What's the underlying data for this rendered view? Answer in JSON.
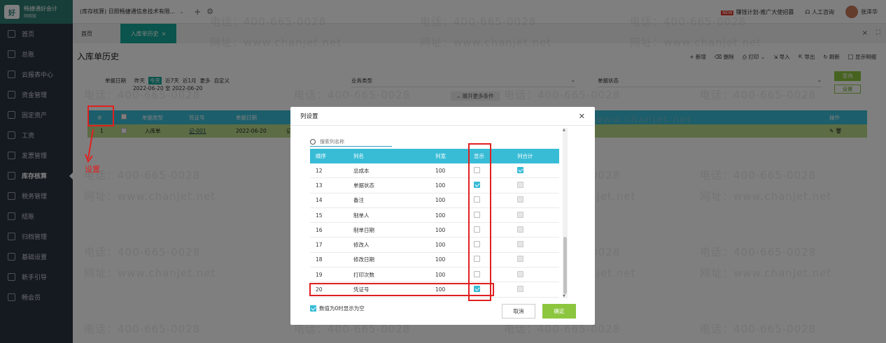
{
  "app": {
    "logo_title": "畅捷通好会计",
    "logo_sub": "网络版",
    "logo_mark": "好"
  },
  "topbar": {
    "account": "(库存核算) 日照畅捷通信息技术有限...",
    "promo": "赚钱计划-推广大使招募",
    "promo_badge": "NEW",
    "support": "人工咨询",
    "user": "张泽华"
  },
  "sidebar": {
    "items": [
      {
        "label": "首页"
      },
      {
        "label": "总账"
      },
      {
        "label": "云报表中心"
      },
      {
        "label": "资金管理"
      },
      {
        "label": "固定资产"
      },
      {
        "label": "工资"
      },
      {
        "label": "发票管理"
      },
      {
        "label": "库存核算"
      },
      {
        "label": "税务管理"
      },
      {
        "label": "结账"
      },
      {
        "label": "归档管理"
      },
      {
        "label": "基础设置"
      },
      {
        "label": "新手引导"
      },
      {
        "label": "畅会员"
      }
    ]
  },
  "tabs": {
    "home": "首页",
    "active": "入库单历史"
  },
  "page": {
    "title": "入库单历史",
    "toolbar": [
      "新增",
      "删除",
      "打印",
      "导入",
      "导出",
      "刷新",
      "显示明细"
    ]
  },
  "filters": {
    "date_label": "单据日期",
    "quick": [
      "昨天",
      "今天",
      "近7天",
      "近1月",
      "更多",
      "自定义"
    ],
    "date_range": "2022-06-20 至 2022-06-20",
    "biz_type_label": "业务类型",
    "status_label": "单据状态",
    "query_button": "查询",
    "settings_button": "设置",
    "more_conditions": "展开更多条件"
  },
  "main_table": {
    "headers": [
      "单据类型",
      "凭证号",
      "单据日期",
      "操作"
    ],
    "row": {
      "no": "1",
      "type": "入库单",
      "voucher": "记-001",
      "date": "2022-06-20",
      "extra": "记"
    }
  },
  "dialog": {
    "title": "列设置",
    "search_placeholder": "搜索列名称",
    "headers": [
      "顺序",
      "列名",
      "列宽",
      "显示",
      "列合计"
    ],
    "rows": [
      {
        "order": "12",
        "name": "总成本",
        "width": "100",
        "show": false,
        "sum": true
      },
      {
        "order": "13",
        "name": "单据状态",
        "width": "100",
        "show": true,
        "sum": false
      },
      {
        "order": "14",
        "name": "备注",
        "width": "100",
        "show": false,
        "sum": false
      },
      {
        "order": "15",
        "name": "制单人",
        "width": "100",
        "show": false,
        "sum": false
      },
      {
        "order": "16",
        "name": "制单日期",
        "width": "100",
        "show": false,
        "sum": false
      },
      {
        "order": "17",
        "name": "修改人",
        "width": "100",
        "show": false,
        "sum": false
      },
      {
        "order": "18",
        "name": "修改日期",
        "width": "100",
        "show": false,
        "sum": false
      },
      {
        "order": "19",
        "name": "打印次数",
        "width": "100",
        "show": false,
        "sum": false
      },
      {
        "order": "20",
        "name": "凭证号",
        "width": "100",
        "show": true,
        "sum": false
      }
    ],
    "zero_option": "数值为0时显示为空",
    "cancel": "取消",
    "ok": "确定"
  },
  "annotation": {
    "label": "设置"
  },
  "watermark": {
    "phone": "电话：400-665-0028",
    "site": "网址：www.chanjet.net"
  },
  "colors": {
    "accent": "#38bcd6",
    "primary_button": "#8cc63f",
    "sidebar": "#2b3340",
    "highlight": "#e02020",
    "tab_active": "#16a89a"
  }
}
